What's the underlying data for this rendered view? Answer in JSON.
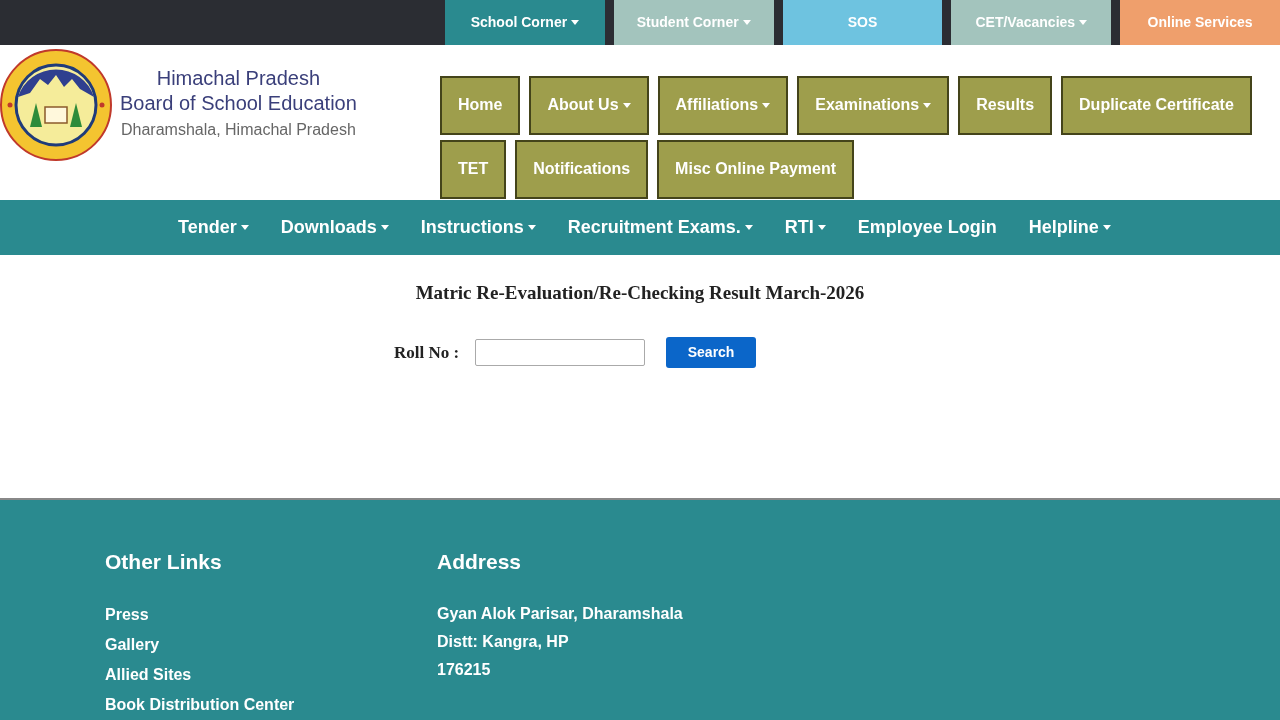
{
  "top_tabs": [
    {
      "label": "School Corner",
      "dropdown": true,
      "color": "#2a8a8f"
    },
    {
      "label": "Student Corner",
      "dropdown": true,
      "color": "#a3c4bd"
    },
    {
      "label": "SOS",
      "dropdown": false,
      "color": "#6ec3e0"
    },
    {
      "label": "CET/Vacancies",
      "dropdown": true,
      "color": "#a3c4bd"
    },
    {
      "label": "Online Services",
      "dropdown": false,
      "color": "#ef9f6c"
    }
  ],
  "brand": {
    "title": "Himachal Pradesh",
    "subtitle": "Board of School Education",
    "location": "Dharamshala, Himachal Pradesh"
  },
  "main_menu": [
    [
      {
        "label": "Home",
        "dropdown": false
      },
      {
        "label": "About Us",
        "dropdown": true
      },
      {
        "label": "Affiliations",
        "dropdown": true
      },
      {
        "label": "Examinations",
        "dropdown": true
      },
      {
        "label": "Results",
        "dropdown": false
      },
      {
        "label": "Duplicate Certificate",
        "dropdown": false
      }
    ],
    [
      {
        "label": "TET",
        "dropdown": false
      },
      {
        "label": "Notifications",
        "dropdown": false
      },
      {
        "label": "Misc Online Payment",
        "dropdown": false
      }
    ]
  ],
  "secondary_menu": [
    {
      "label": "Tender",
      "dropdown": true
    },
    {
      "label": "Downloads",
      "dropdown": true
    },
    {
      "label": "Instructions",
      "dropdown": true
    },
    {
      "label": "Recruitment Exams.",
      "dropdown": true
    },
    {
      "label": "RTI",
      "dropdown": true
    },
    {
      "label": "Employee Login",
      "dropdown": false
    },
    {
      "label": "Helpline",
      "dropdown": true
    }
  ],
  "form": {
    "heading": "Matric Re-Evaluation/Re-Checking Result March-2026",
    "label": "Roll No :",
    "button": "Search"
  },
  "footer": {
    "links_title": "Other Links",
    "links": [
      "Press",
      "Gallery",
      "Allied Sites",
      "Book Distribution Center"
    ],
    "address_title": "Address",
    "address": [
      "Gyan Alok Parisar, Dharamshala",
      "Distt: Kangra, HP",
      "176215"
    ]
  }
}
